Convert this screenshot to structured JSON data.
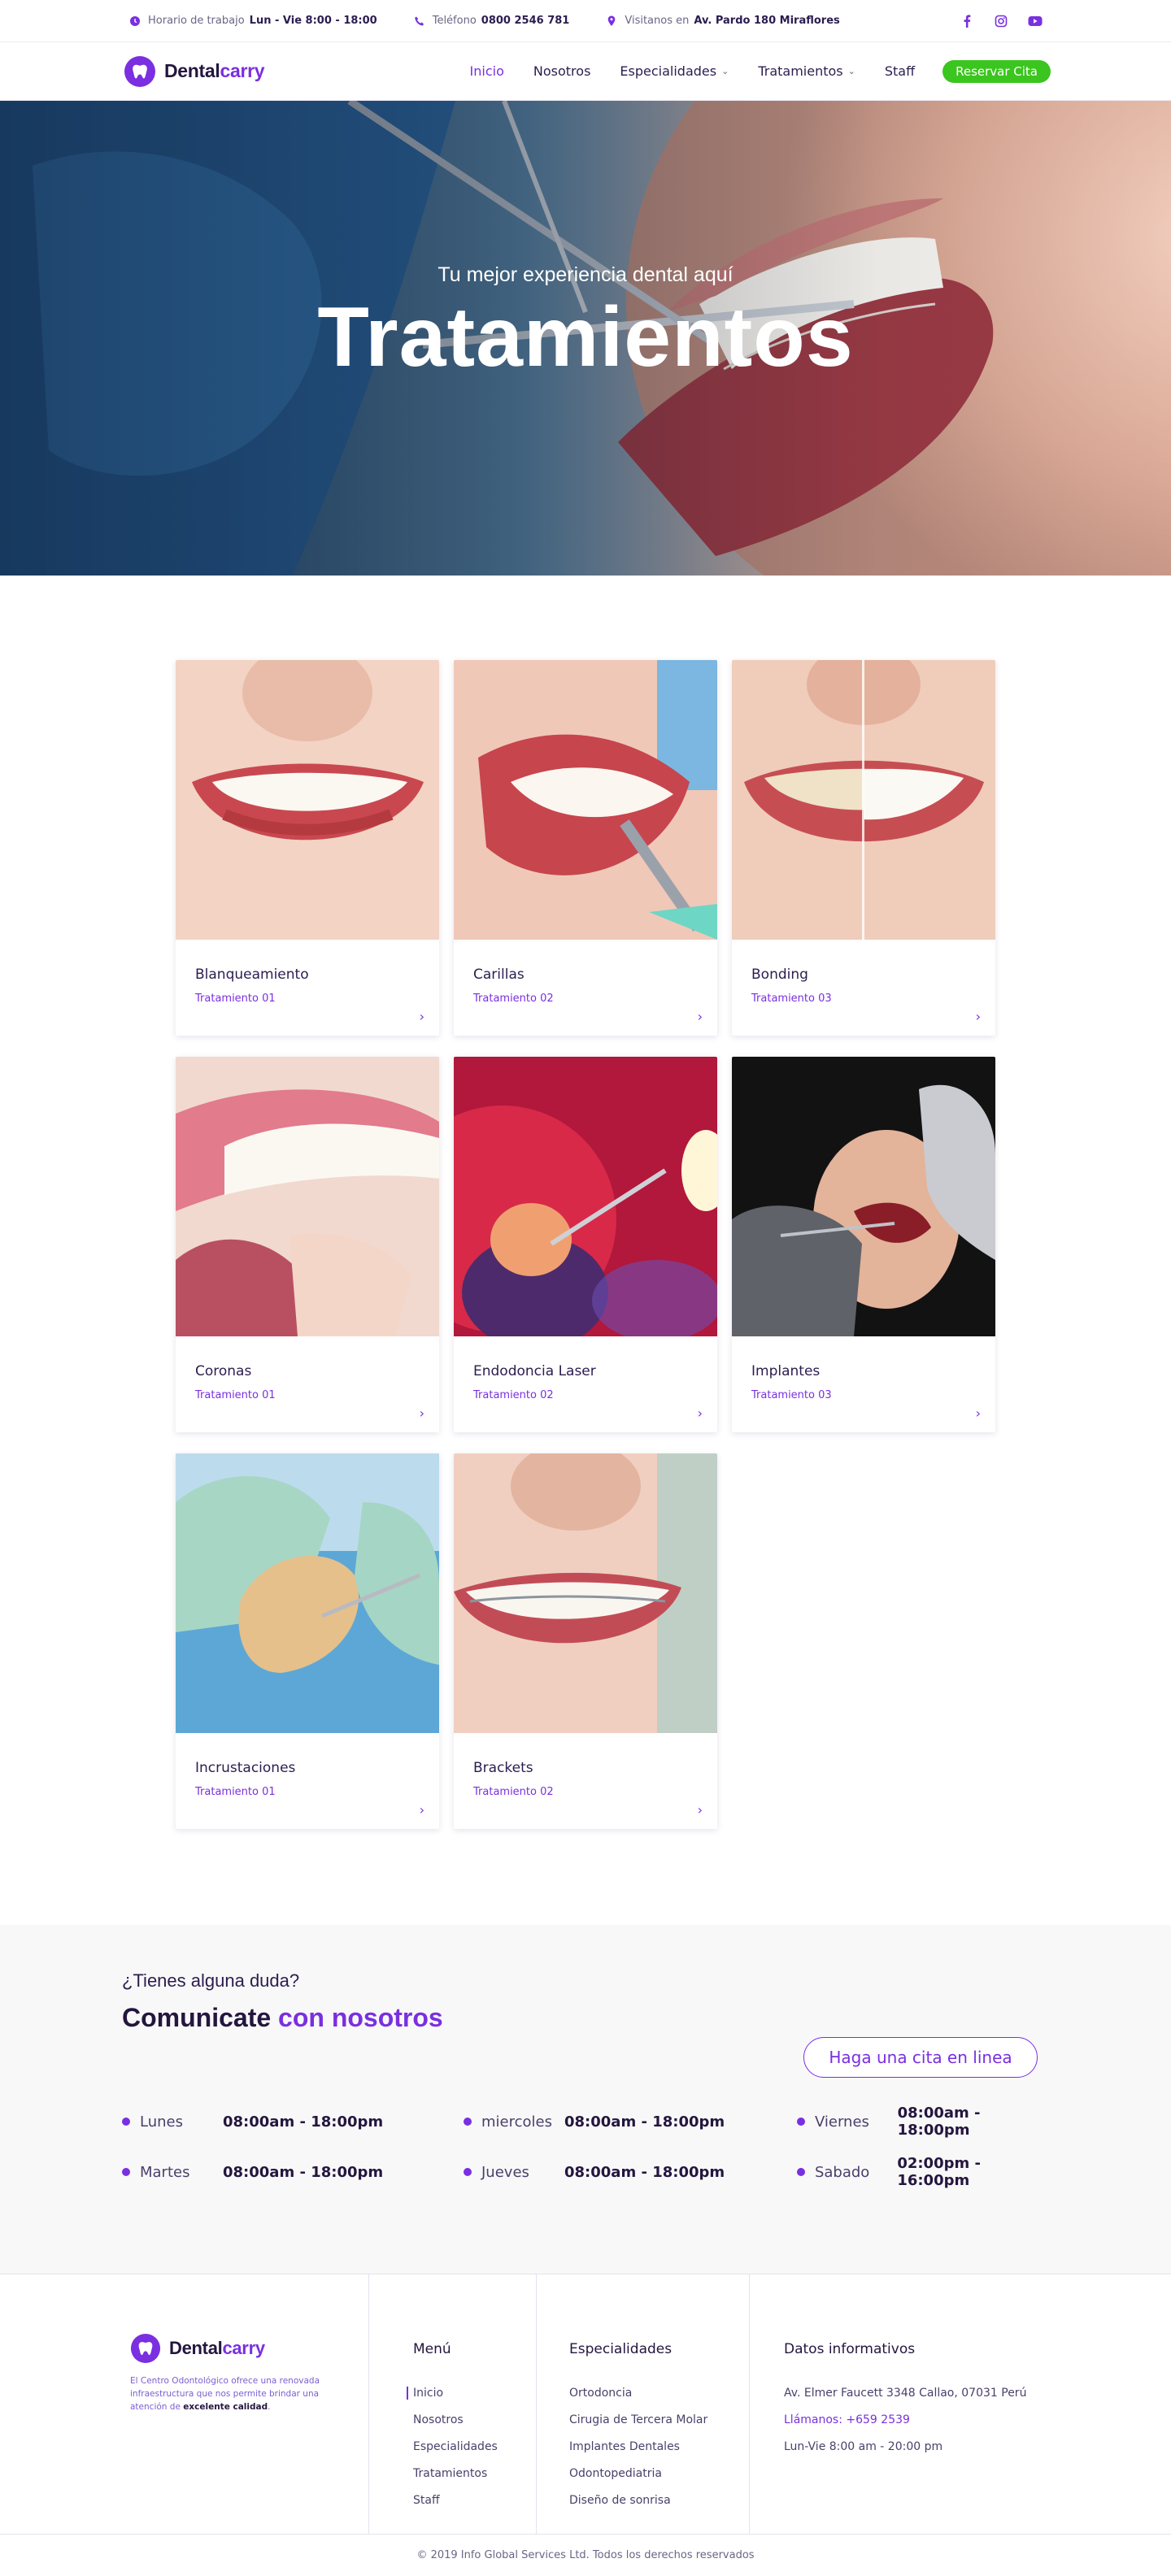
{
  "colors": {
    "brand": "#7a2fe0",
    "cta": "#3bc51f",
    "ink": "#24163f",
    "band": "#f8f8f8"
  },
  "topbar": {
    "hours_label": "Horario de trabajo",
    "hours_value": "Lun - Vie 8:00 - 18:00",
    "phone_label": "Teléfono",
    "phone_value": "0800 2546 781",
    "address_label": "Visitanos en",
    "address_value": "Av. Pardo 180 Miraflores",
    "social": [
      "facebook-icon",
      "instagram-icon",
      "youtube-icon"
    ]
  },
  "nav": {
    "logo_part1": "Dental",
    "logo_part2": "carry",
    "items": [
      {
        "label": "Inicio",
        "active": true,
        "dropdown": false
      },
      {
        "label": "Nosotros",
        "active": false,
        "dropdown": false
      },
      {
        "label": "Especialidades",
        "active": false,
        "dropdown": true
      },
      {
        "label": "Tratamientos",
        "active": false,
        "dropdown": true
      },
      {
        "label": "Staff",
        "active": false,
        "dropdown": false
      }
    ],
    "cta": "Reservar Cita"
  },
  "hero": {
    "kicker": "Tu mejor experiencia dental aquí",
    "title": "Tratamientos"
  },
  "treatments": [
    {
      "name": "Blanqueamiento",
      "sub": "Tratamiento 01"
    },
    {
      "name": "Carillas",
      "sub": "Tratamiento 02"
    },
    {
      "name": "Bonding",
      "sub": "Tratamiento 03"
    },
    {
      "name": "Coronas",
      "sub": "Tratamiento 01"
    },
    {
      "name": "Endodoncia Laser",
      "sub": "Tratamiento 02"
    },
    {
      "name": "Implantes",
      "sub": "Tratamiento 03"
    },
    {
      "name": "Incrustaciones",
      "sub": "Tratamiento 01"
    },
    {
      "name": "Brackets",
      "sub": "Tratamiento 02"
    }
  ],
  "contact": {
    "question": "¿Tienes alguna duda?",
    "heading_part1": "Comunicate",
    "heading_part2": "con nosotros",
    "button": "Haga una cita en linea",
    "hours": [
      {
        "day": "Lunes",
        "time": "08:00am - 18:00pm"
      },
      {
        "day": "miercoles",
        "time": "08:00am - 18:00pm"
      },
      {
        "day": "Viernes",
        "time": "08:00am - 18:00pm"
      },
      {
        "day": "Martes",
        "time": "08:00am - 18:00pm"
      },
      {
        "day": "Jueves",
        "time": "08:00am - 18:00pm"
      },
      {
        "day": "Sabado",
        "time": "02:00pm - 16:00pm"
      }
    ]
  },
  "footer": {
    "logo_part1": "Dental",
    "logo_part2": "carry",
    "about": "El Centro Odontológico ofrece una renovada infraestructura que nos permite brindar una atención de",
    "about_bold": "excelente calidad",
    "menu_title": "Menú",
    "menu": [
      "Inicio",
      "Nosotros",
      "Especialidades",
      "Tratamientos",
      "Staff"
    ],
    "spec_title": "Especialidades",
    "specialties": [
      "Ortodoncia",
      "Cirugia de Tercera Molar",
      "Implantes Dentales",
      "Odontopediatria",
      "Diseño de sonrisa"
    ],
    "info_title": "Datos informativos",
    "address": "Av. Elmer Faucett 3348 Callao, 07031 Perú",
    "phone": "Llámanos: +659 2539",
    "hours": "Lun-Vie 8:00 am - 20:00 pm",
    "copyright": "© 2019 Info Global Services Ltd. Todos los derechos reservados"
  }
}
